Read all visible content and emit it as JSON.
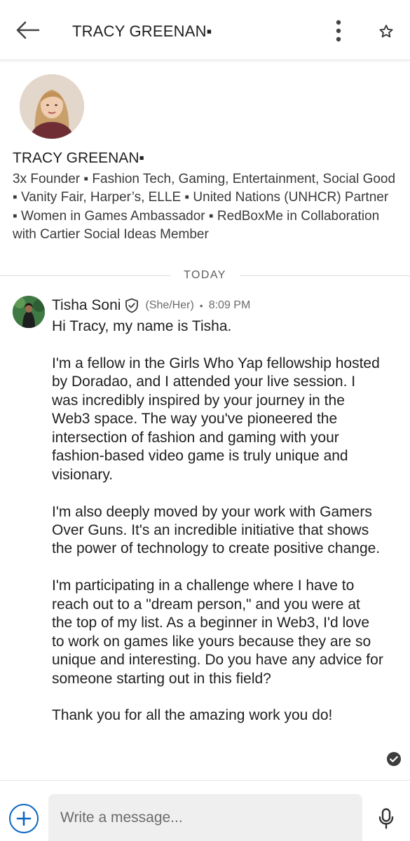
{
  "header": {
    "title": "TRACY GREENAN▪",
    "back_icon": "arrow-left-icon",
    "more_icon": "more-vertical-icon",
    "star_icon": "star-outline-icon"
  },
  "profile": {
    "name": "TRACY GREENAN▪",
    "headline": "3x Founder ▪ Fashion Tech, Gaming, Entertainment, Social Good ▪ Vanity Fair, Harper’s, ELLE ▪ United Nations (UNHCR) Partner ▪ Women in Games Ambassador ▪ RedBoxMe in Collaboration with Cartier Social Ideas Member"
  },
  "divider": {
    "label": "TODAY"
  },
  "message": {
    "sender": "Tisha Soni",
    "pronouns": "(She/Her)",
    "separator": "•",
    "time": "8:09 PM",
    "paragraphs": [
      "Hi Tracy, my name is Tisha.",
      "I'm a fellow in the Girls Who Yap fellowship hosted by Doradao, and I attended your live session. I was incredibly inspired by your journey in the Web3 space. The way you've pioneered the intersection of fashion and gaming with your fashion-based video game is truly unique and visionary.",
      "I'm also deeply moved by your work with Gamers Over Guns. It's an incredible initiative that shows the power of technology to create positive change.",
      "I'm participating in a challenge where I have to reach out to a \"dream person,\" and you were at the top of my list. As a beginner in Web3, I'd love to work on games like yours because they are so unique and interesting. Do you have any advice for someone starting out in this field?",
      "Thank you for all the amazing work you do!"
    ]
  },
  "composer": {
    "placeholder": "Write a message...",
    "value": ""
  },
  "colors": {
    "accent": "#0a66c2",
    "text": "#1f1f1f",
    "muted": "#6b6b6b",
    "input_bg": "#efefef"
  }
}
